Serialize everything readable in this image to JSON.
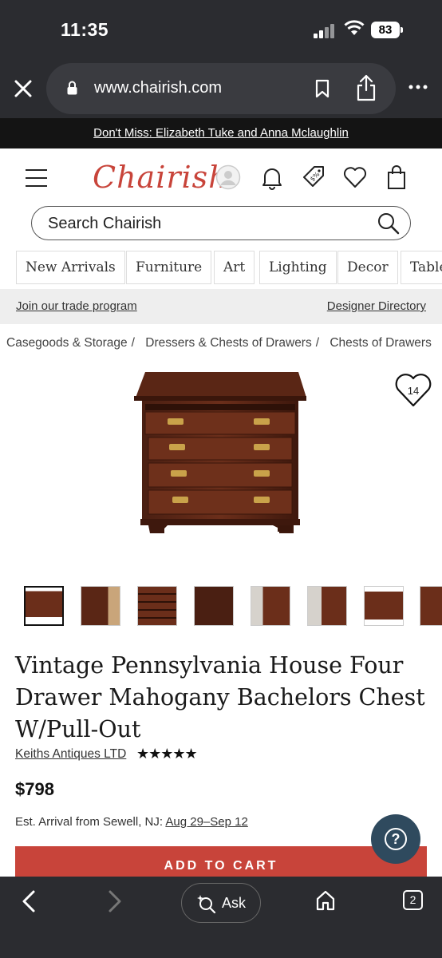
{
  "status": {
    "time": "11:35",
    "battery": "83"
  },
  "browser": {
    "url": "www.chairish.com",
    "tab_count": "2",
    "ask_label": "Ask"
  },
  "promo": {
    "text": "Don't Miss: Elizabeth Tuke and Anna Mclaughlin"
  },
  "header": {
    "logo": "Chairish"
  },
  "search": {
    "placeholder": "Search Chairish"
  },
  "categories": [
    "New Arrivals",
    "Furniture",
    "Art",
    "Lighting",
    "Decor",
    "Table"
  ],
  "trade": {
    "join": "Join our trade program",
    "directory": "Designer Directory"
  },
  "breadcrumb": [
    "Casegoods & Storage",
    "Dressers & Chests of Drawers",
    "Chests of Drawers"
  ],
  "product": {
    "favorites": "14",
    "title": "Vintage Pennsylvania House Four Drawer Mahogany Bachelors Chest W/Pull-Out",
    "seller": "Keiths Antiques LTD",
    "rating_stars": "★★★★★",
    "rating": 4.5,
    "price": "$798",
    "arrival_label": "Est. Arrival from Sewell, NJ:",
    "arrival_dates": "Aug 29–Sep 12",
    "add_to_cart": "ADD TO CART"
  },
  "colors": {
    "brand": "#c8443a",
    "chrome": "#2b2c30",
    "help": "#2f4a5e"
  }
}
